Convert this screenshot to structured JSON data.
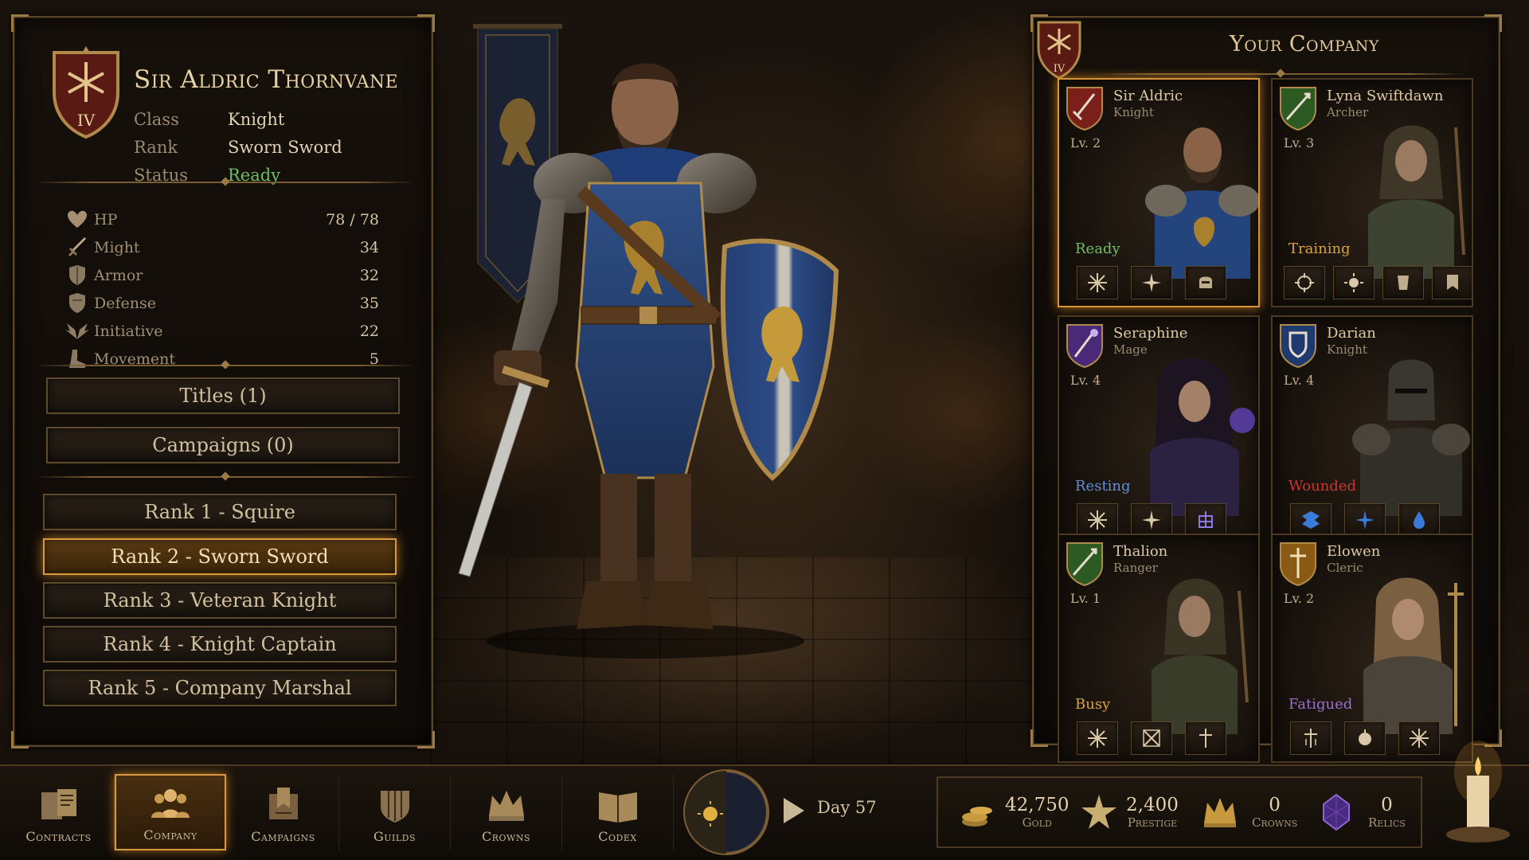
{
  "hero": {
    "name": "Sir Aldric Thornvane",
    "crest_numeral": "IV",
    "info": [
      {
        "label": "Class",
        "value": "Knight"
      },
      {
        "label": "Rank",
        "value": "Sworn Sword"
      },
      {
        "label": "Status",
        "value": "Ready"
      }
    ],
    "stats": [
      {
        "icon": "heart-icon",
        "label": "HP",
        "value": "78 / 78"
      },
      {
        "icon": "sword-icon",
        "label": "Might",
        "value": "34"
      },
      {
        "icon": "shield-icon",
        "label": "Armor",
        "value": "32"
      },
      {
        "icon": "shield-icon",
        "label": "Defense",
        "value": "35"
      },
      {
        "icon": "wings-icon",
        "label": "Initiative",
        "value": "22"
      },
      {
        "icon": "boot-icon",
        "label": "Movement",
        "value": "5"
      }
    ],
    "titles_button": "Titles (1)",
    "campaigns_button": "Campaigns (0)",
    "ranks": [
      {
        "label": "Rank 1 - Squire",
        "active": false
      },
      {
        "label": "Rank 2 - Sworn Sword",
        "active": true
      },
      {
        "label": "Rank 3 - Veteran Knight",
        "active": false
      },
      {
        "label": "Rank 4 - Knight Captain",
        "active": false
      },
      {
        "label": "Rank 5 - Company Marshal",
        "active": false
      }
    ]
  },
  "company": {
    "title": "Your Company",
    "crest_numeral": "IV",
    "members": [
      {
        "name": "Sir Aldric",
        "class": "Knight",
        "level": "Lv. 2",
        "status": "Ready",
        "status_color": "#6fbd62",
        "emblem_color": "#7a1f1a",
        "selected": true
      },
      {
        "name": "Lyna Swiftdawn",
        "class": "Archer",
        "level": "Lv. 3",
        "status": "Training",
        "status_color": "#d8a440",
        "emblem_color": "#2d5a22",
        "selected": false
      },
      {
        "name": "Seraphine",
        "class": "Mage",
        "level": "Lv. 4",
        "status": "Resting",
        "status_color": "#5f8fd8",
        "emblem_color": "#4a2a78",
        "selected": false
      },
      {
        "name": "Darian",
        "class": "Knight",
        "level": "Lv. 4",
        "status": "Wounded",
        "status_color": "#c8372d",
        "emblem_color": "#1e3a70",
        "selected": false
      },
      {
        "name": "Thalion",
        "class": "Ranger",
        "level": "Lv. 1",
        "status": "Busy",
        "status_color": "#d8a440",
        "emblem_color": "#2d5a22",
        "selected": false
      },
      {
        "name": "Elowen",
        "class": "Cleric",
        "level": "Lv. 2",
        "status": "Fatigued",
        "status_color": "#9a6fd0",
        "emblem_color": "#8a5a14",
        "selected": false
      }
    ]
  },
  "nav": [
    {
      "label": "Contracts",
      "icon": "contracts-icon",
      "active": false
    },
    {
      "label": "Company",
      "icon": "company-icon",
      "active": true
    },
    {
      "label": "Campaigns",
      "icon": "campaigns-icon",
      "active": false
    },
    {
      "label": "Guilds",
      "icon": "guilds-icon",
      "active": false
    },
    {
      "label": "Crowns",
      "icon": "crown-icon",
      "active": false
    },
    {
      "label": "Codex",
      "icon": "codex-icon",
      "active": false
    }
  ],
  "day": "Day 57",
  "resources": [
    {
      "icon": "gold-icon",
      "value": "42,750",
      "label": "Gold"
    },
    {
      "icon": "prestige-star-icon",
      "value": "2,400",
      "label": "Prestige"
    },
    {
      "icon": "crown-icon",
      "value": "0",
      "label": "Crowns"
    },
    {
      "icon": "relic-gem-icon",
      "value": "0",
      "label": "Relics"
    }
  ],
  "colors": {
    "accent_gold": "#d89a3c",
    "ready_green": "#6fbd62",
    "panel_border": "#5b4528"
  }
}
